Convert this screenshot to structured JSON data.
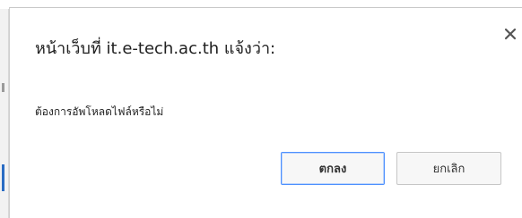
{
  "dialog": {
    "title": "หน้าเว็บที่ it.e-tech.ac.th แจ้งว่า:",
    "message": "ต้องการอัพโหลดไฟล์หรือไม่",
    "close_icon": "close-icon",
    "ok_label": "ตกลง",
    "cancel_label": "ยกเลิก",
    "accent_color": "#4d90fe"
  }
}
